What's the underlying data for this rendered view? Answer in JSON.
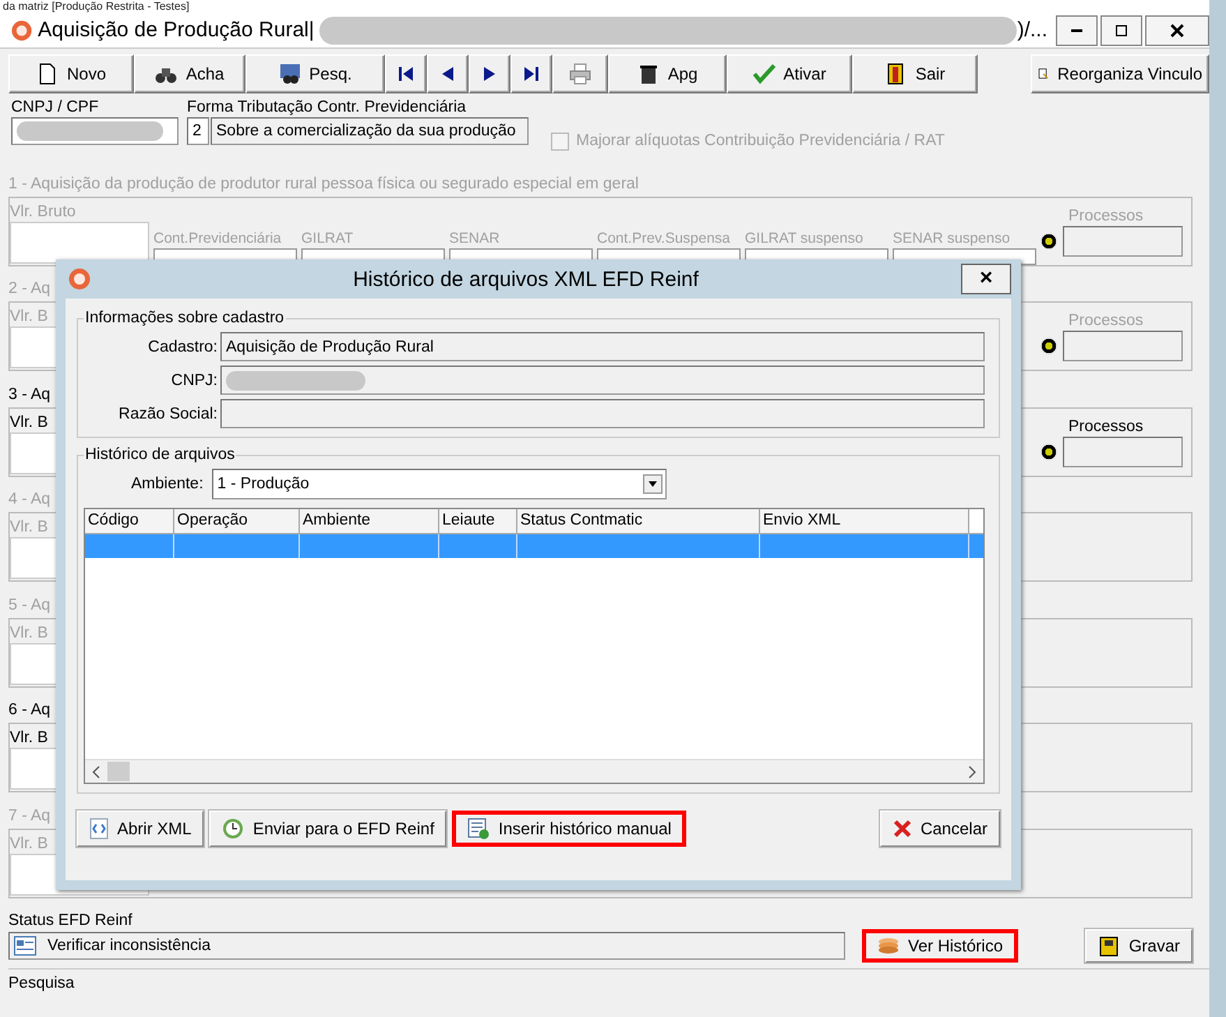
{
  "top_strip": {
    "text": "da matriz [Produção Restrita - Testes]"
  },
  "window": {
    "title": "Aquisição de Produção Rural|",
    "title_suffix": ")/..."
  },
  "toolbar": [
    {
      "kind": "button",
      "label": "Novo"
    },
    {
      "kind": "button",
      "label": "Acha"
    },
    {
      "kind": "button",
      "label": "Pesq."
    },
    {
      "kind": "first"
    },
    {
      "kind": "prev"
    },
    {
      "kind": "next"
    },
    {
      "kind": "last"
    },
    {
      "kind": "print"
    },
    {
      "kind": "button",
      "label": "Apg"
    },
    {
      "kind": "button",
      "label": "Ativar"
    },
    {
      "kind": "button",
      "label": "Sair"
    },
    {
      "kind": "button",
      "label": "Reorganiza Vinculo"
    }
  ],
  "header": {
    "cnpj_label": "CNPJ / CPF",
    "forma_label": "Forma Tributação Contr. Previdenciária",
    "forma_code": "2",
    "forma_value": "Sobre a comercialização da sua produção",
    "majorar": {
      "label": "Majorar alíquotas Contribuição Previdenciária / RAT",
      "checked": false,
      "disabled": true
    }
  },
  "sections": [
    {
      "label": "1 - Aquisição da produção de produtor rural pessoa física ou segurado especial em geral",
      "disabled": true,
      "value_label": "Vlr. Bruto",
      "fields": [
        {
          "kind": "text",
          "label": "Cont.Previdenciária"
        },
        {
          "kind": "text",
          "label": "GILRAT"
        },
        {
          "kind": "text",
          "label": "SENAR"
        },
        {
          "kind": "text",
          "label": "Cont.Prev.Suspensa"
        },
        {
          "kind": "text",
          "label": "GILRAT suspenso"
        },
        {
          "kind": "text",
          "label": "SENAR suspenso"
        },
        {
          "kind": "processos",
          "label": "Processos"
        }
      ]
    },
    {
      "label": "2 - Aq",
      "disabled": true,
      "value_label": "Vlr. B",
      "fields": [
        {
          "kind": "processos",
          "label": "Processos"
        }
      ]
    },
    {
      "label": "3 - Aq",
      "disabled": false,
      "value_label": "Vlr. B",
      "fields": [
        {
          "kind": "processos",
          "label": "Processos"
        }
      ]
    },
    {
      "label": "4 - Aq",
      "disabled": true,
      "value_label": "Vlr. B"
    },
    {
      "label": "5 - Aq",
      "disabled": true,
      "value_label": "Vlr. B"
    },
    {
      "label": "6 - Aq",
      "disabled": false,
      "value_label": "Vlr. B"
    },
    {
      "label": "7 - Aq",
      "disabled": true,
      "value_label": "Vlr. B"
    }
  ],
  "status": {
    "label": "Status EFD Reinf",
    "value": "Verificar inconsistência",
    "history_button": {
      "label": "Ver Histórico",
      "highlighted": true
    },
    "save_button": {
      "label": "Gravar",
      "highlighted": false
    }
  },
  "status_bar": "Pesquisa",
  "dialog": {
    "title": "Histórico de arquivos XML EFD Reinf",
    "close": "×",
    "info_group": {
      "title": "Informações sobre cadastro",
      "rows": [
        {
          "label": "Cadastro:",
          "value": "Aquisição de Produção Rural",
          "redacted": false
        },
        {
          "label": "CNPJ:",
          "value": "",
          "redacted": true
        },
        {
          "label": "Razão Social:",
          "value": "",
          "redacted": false
        }
      ]
    },
    "history_group": {
      "title": "Histórico de arquivos",
      "ambiente_label": "Ambiente:",
      "ambiente_value": "1 - Produção",
      "table": {
        "columns": [
          "Código",
          "Operação",
          "Ambiente",
          "Leiaute",
          "Status Contmatic",
          "Envio XML"
        ],
        "rows": [
          {
            "selected": true
          }
        ]
      }
    },
    "buttons": [
      {
        "label": "Abrir XML",
        "highlighted": false
      },
      {
        "label": "Enviar para o EFD Reinf",
        "highlighted": false
      },
      {
        "label": "Inserir histórico manual",
        "highlighted": true
      },
      {
        "label": "Cancelar",
        "highlighted": false
      }
    ]
  }
}
